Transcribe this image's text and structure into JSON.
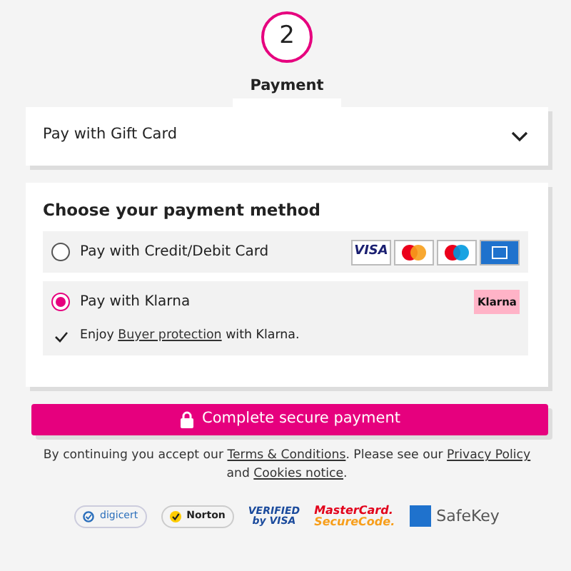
{
  "step": {
    "number": "2",
    "label": "Payment"
  },
  "gift_card": {
    "label": "Pay with Gift Card",
    "expanded": false
  },
  "payment": {
    "title": "Choose your payment method",
    "options": [
      {
        "label": "Pay with Credit/Debit Card",
        "selected": false,
        "logos": [
          {
            "kind": "visa",
            "text": "VISA"
          },
          {
            "kind": "mastercard"
          },
          {
            "kind": "maestro"
          },
          {
            "kind": "amex"
          }
        ]
      },
      {
        "label": "Pay with Klarna",
        "selected": true,
        "logos": [
          {
            "kind": "klarna",
            "text": "Klarna"
          }
        ],
        "note": [
          {
            "kind": "text",
            "text": "Enjoy"
          },
          {
            "kind": "link",
            "text": "Buyer protection"
          },
          {
            "kind": "text",
            "text": "with Klarna."
          }
        ]
      }
    ]
  },
  "submit": {
    "label": "Complete secure payment"
  },
  "legal": [
    {
      "kind": "text",
      "text": "By continuing you accept our "
    },
    {
      "kind": "link",
      "text": "Terms & Conditions"
    },
    {
      "kind": "text",
      "text": ". Please see our "
    },
    {
      "kind": "link",
      "text": "Privacy Policy"
    },
    {
      "kind": "text",
      "text": " and "
    },
    {
      "kind": "link",
      "text": "Cookies notice"
    },
    {
      "kind": "text",
      "text": "."
    }
  ],
  "seals": [
    {
      "kind": "digicert",
      "lines": [
        "digicert"
      ]
    },
    {
      "kind": "norton",
      "lines": [
        "Norton"
      ]
    },
    {
      "kind": "verified",
      "lines": [
        "VERIFIED",
        "by VISA"
      ]
    },
    {
      "kind": "securecode",
      "lines": [
        "MasterCard.",
        "SecureCode."
      ]
    },
    {
      "kind": "safekey",
      "lines": [
        "SafeKey"
      ]
    }
  ]
}
